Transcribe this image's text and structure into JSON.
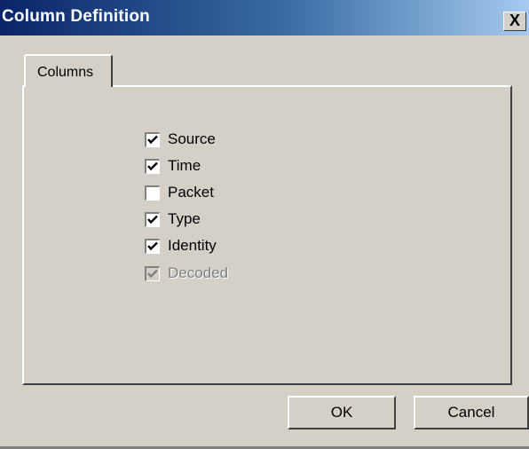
{
  "window": {
    "title": "Column Definition",
    "close_label": "X"
  },
  "tabs": [
    {
      "label": "Columns",
      "selected": true
    }
  ],
  "checkboxes": [
    {
      "label": "Source",
      "checked": true,
      "enabled": true
    },
    {
      "label": "Time",
      "checked": true,
      "enabled": true
    },
    {
      "label": "Packet",
      "checked": false,
      "enabled": true
    },
    {
      "label": "Type",
      "checked": true,
      "enabled": true
    },
    {
      "label": "Identity",
      "checked": true,
      "enabled": true
    },
    {
      "label": "Decoded",
      "checked": true,
      "enabled": false
    }
  ],
  "buttons": {
    "ok_label": "OK",
    "cancel_label": "Cancel"
  },
  "colors": {
    "titlebar_start": "#0a246a",
    "titlebar_end": "#a6caf0",
    "face": "#d4d0c8",
    "disabled_text": "#808080"
  }
}
